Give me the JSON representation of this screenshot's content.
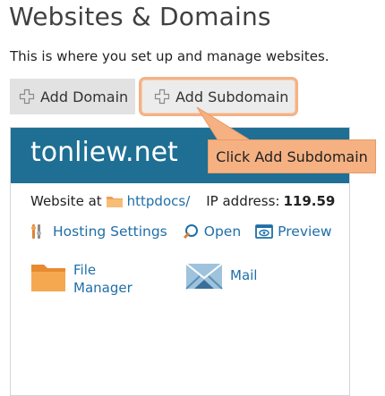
{
  "page": {
    "title": "Websites & Domains",
    "description": "This is where you set up and manage websites."
  },
  "toolbar": {
    "add_domain_label": "Add Domain",
    "add_subdomain_label": "Add Subdomain"
  },
  "site": {
    "name": "tonliew.net",
    "website_at_label": "Website at",
    "docroot": "httpdocs/",
    "ip_label": "IP address:",
    "ip_value": "119.59"
  },
  "actions": {
    "hosting_settings": "Hosting Settings",
    "open": "Open",
    "preview": "Preview"
  },
  "tiles": {
    "file_manager_line1": "File",
    "file_manager_line2": "Manager",
    "mail": "Mail"
  },
  "callout": {
    "text": "Click Add Subdomain"
  },
  "colors": {
    "header_blue": "#1e6f93",
    "callout_orange": "#f6b182",
    "link_blue": "#1f6fa8",
    "folder_orange": "#f0a050"
  }
}
